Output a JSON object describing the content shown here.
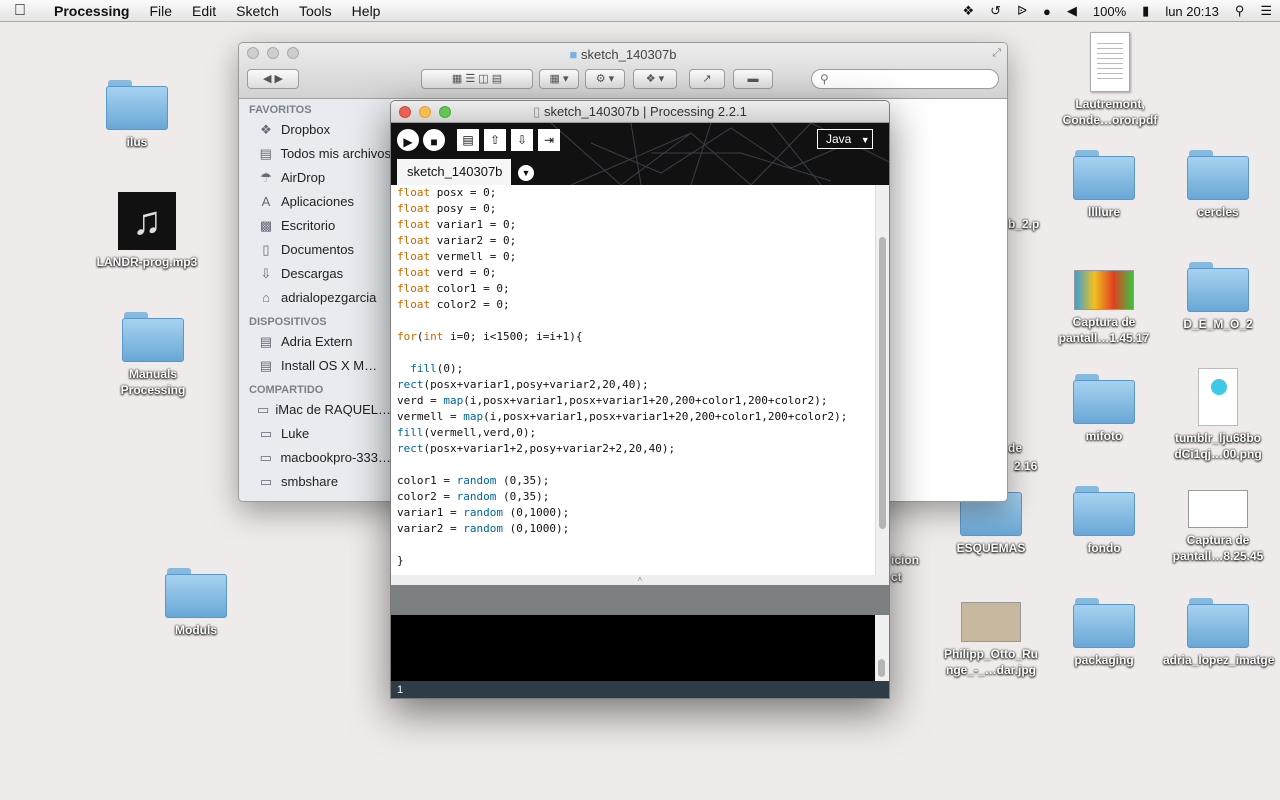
{
  "menubar": {
    "app": "Processing",
    "items": [
      "File",
      "Edit",
      "Sketch",
      "Tools",
      "Help"
    ],
    "battery": "100%",
    "clock": "lun 20:13"
  },
  "desktop": {
    "icons": [
      {
        "label": "ilus",
        "kind": "folder"
      },
      {
        "label": "LANDR-prog.mp3",
        "kind": "music"
      },
      {
        "label": "Manuals Processing",
        "kind": "folder"
      },
      {
        "label": "Moduls",
        "kind": "folder"
      },
      {
        "label": "Lautremont, Conde…oror.pdf",
        "kind": "document"
      },
      {
        "label": "llllure",
        "kind": "folder"
      },
      {
        "label": "cercles",
        "kind": "folder"
      },
      {
        "label": "Captura de pantall…1.45.17",
        "kind": "image"
      },
      {
        "label": "D_E_M_O_2",
        "kind": "folder"
      },
      {
        "label": "mifoto",
        "kind": "folder"
      },
      {
        "label": "tumblr_lju68bo dCi1qj…00.png",
        "kind": "image"
      },
      {
        "label": "ESQUEMAS",
        "kind": "folder"
      },
      {
        "label": "fondo",
        "kind": "folder"
      },
      {
        "label": "Captura de pantall…8.25.45",
        "kind": "image"
      },
      {
        "label": "Philipp_Otto_Ru nge_-_…dar.jpg",
        "kind": "image"
      },
      {
        "label": "packaging",
        "kind": "folder"
      },
      {
        "label": "adria_lopez_imatge",
        "kind": "folder"
      }
    ],
    "partial_labels": [
      "b_2.p",
      "de",
      "2.16",
      "icion",
      "ct"
    ]
  },
  "finder": {
    "title": "sketch_140307b",
    "sidebar": {
      "favorites_header": "FAVORITOS",
      "favorites": [
        {
          "label": "Dropbox",
          "icon": "dropbox-icon"
        },
        {
          "label": "Todos mis archivos",
          "icon": "all-files-icon"
        },
        {
          "label": "AirDrop",
          "icon": "airdrop-icon"
        },
        {
          "label": "Aplicaciones",
          "icon": "applications-icon"
        },
        {
          "label": "Escritorio",
          "icon": "desktop-icon"
        },
        {
          "label": "Documentos",
          "icon": "documents-icon"
        },
        {
          "label": "Descargas",
          "icon": "downloads-icon"
        },
        {
          "label": "adrialopezgarcia",
          "icon": "home-icon"
        }
      ],
      "devices_header": "DISPOSITIVOS",
      "devices": [
        {
          "label": "Adria Extern",
          "icon": "drive-icon"
        },
        {
          "label": "Install OS X M…",
          "icon": "drive-icon"
        }
      ],
      "shared_header": "COMPARTIDO",
      "shared": [
        {
          "label": "iMac de RAQUEL…",
          "icon": "computer-icon"
        },
        {
          "label": "Luke",
          "icon": "computer-icon"
        },
        {
          "label": "macbookpro-333…",
          "icon": "computer-icon"
        },
        {
          "label": "smbshare",
          "icon": "computer-icon"
        }
      ]
    }
  },
  "processing": {
    "title": "sketch_140307b | Processing 2.2.1",
    "mode": "Java",
    "tab": "sketch_140307b",
    "line_number": "1",
    "code": [
      [
        {
          "t": "float",
          "c": "kw"
        },
        {
          "t": " posx = 0;"
        }
      ],
      [
        {
          "t": "float",
          "c": "kw"
        },
        {
          "t": " posy = 0;"
        }
      ],
      [
        {
          "t": "float",
          "c": "kw"
        },
        {
          "t": " variar1 = 0;"
        }
      ],
      [
        {
          "t": "float",
          "c": "kw"
        },
        {
          "t": " variar2 = 0;"
        }
      ],
      [
        {
          "t": "float",
          "c": "kw"
        },
        {
          "t": " vermell = 0;"
        }
      ],
      [
        {
          "t": "float",
          "c": "kw"
        },
        {
          "t": " verd = 0;"
        }
      ],
      [
        {
          "t": "float",
          "c": "kw"
        },
        {
          "t": " color1 = 0;"
        }
      ],
      [
        {
          "t": "float",
          "c": "kw"
        },
        {
          "t": " color2 = 0;"
        }
      ],
      [],
      [
        {
          "t": "for",
          "c": "kw"
        },
        {
          "t": "("
        },
        {
          "t": "int",
          "c": "kw"
        },
        {
          "t": " i=0; i<1500; i=i+1){"
        }
      ],
      [],
      [
        {
          "t": "  "
        },
        {
          "t": "fill",
          "c": "fn"
        },
        {
          "t": "(0);"
        }
      ],
      [
        {
          "t": "rect",
          "c": "fn"
        },
        {
          "t": "(posx+variar1,posy+variar2,20,40);"
        }
      ],
      [
        {
          "t": "verd = "
        },
        {
          "t": "map",
          "c": "fn"
        },
        {
          "t": "(i,posx+variar1,posx+variar1+20,200+color1,200+color2);"
        }
      ],
      [
        {
          "t": "vermell = "
        },
        {
          "t": "map",
          "c": "fn"
        },
        {
          "t": "(i,posx+variar1,posx+variar1+20,200+color1,200+color2);"
        }
      ],
      [
        {
          "t": "fill",
          "c": "fn"
        },
        {
          "t": "(vermell,verd,0);"
        }
      ],
      [
        {
          "t": "rect",
          "c": "fn"
        },
        {
          "t": "(posx+variar1+2,posy+variar2+2,20,40);"
        }
      ],
      [],
      [
        {
          "t": "color1 = "
        },
        {
          "t": "random",
          "c": "fn"
        },
        {
          "t": " (0,35);"
        }
      ],
      [
        {
          "t": "color2 = "
        },
        {
          "t": "random",
          "c": "fn"
        },
        {
          "t": " (0,35);"
        }
      ],
      [
        {
          "t": "variar1 = "
        },
        {
          "t": "random",
          "c": "fn"
        },
        {
          "t": " (0,1000);"
        }
      ],
      [
        {
          "t": "variar2 = "
        },
        {
          "t": "random",
          "c": "fn"
        },
        {
          "t": " (0,1000);"
        }
      ],
      [],
      [
        {
          "t": "}"
        }
      ]
    ]
  }
}
